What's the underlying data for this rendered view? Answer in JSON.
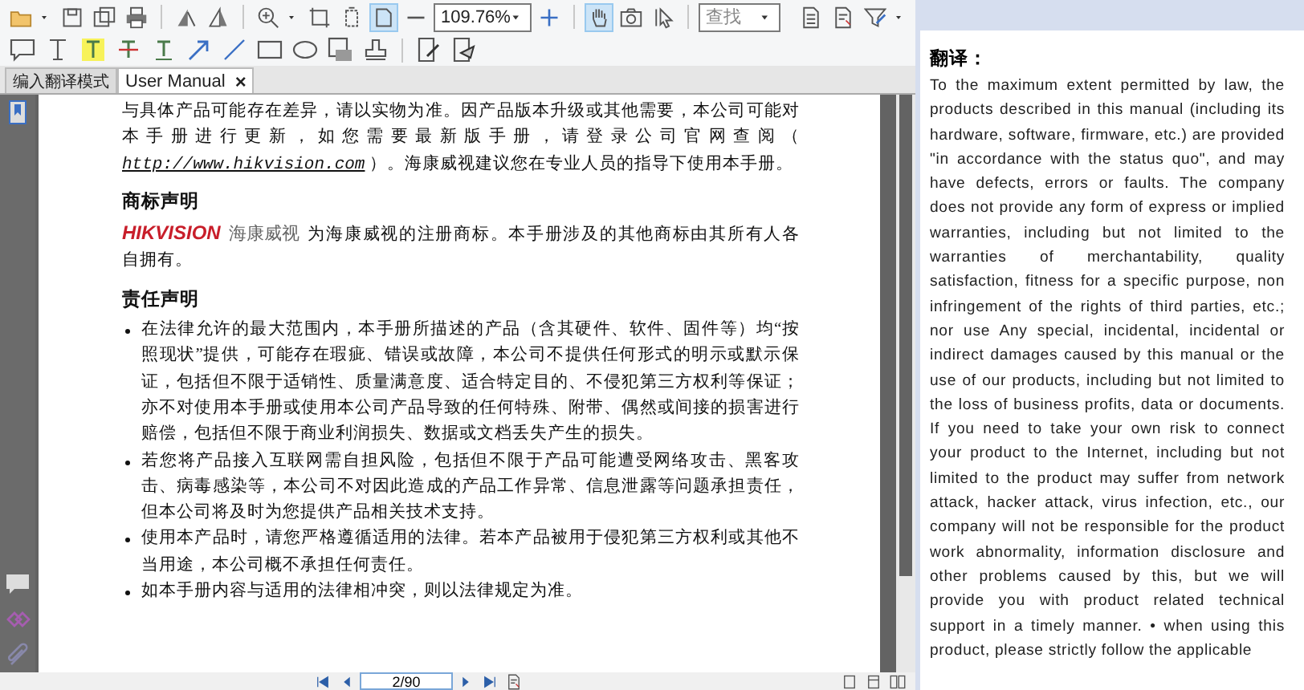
{
  "toolbar": {
    "zoom_value": "109.76%",
    "search_value": "查找",
    "tools": [
      {
        "selected": false
      },
      {
        "selected": false
      },
      {
        "selected": false
      },
      {
        "selected": false
      },
      {
        "selected": false
      },
      {
        "selected": false
      },
      {
        "selected": false
      },
      {
        "selected": false
      },
      {
        "selected": false
      },
      {
        "selected": true
      },
      {
        "selected": false
      },
      {
        "selected": false
      },
      {
        "selected": true
      },
      {
        "selected": false
      },
      {
        "selected": false
      },
      {
        "selected": false
      },
      {
        "selected": false
      },
      {
        "selected": false
      }
    ]
  },
  "tabs": [
    {
      "label": "编入翻译模式",
      "selected": false
    },
    {
      "label": "User Manual",
      "selected": true,
      "close": "×"
    }
  ],
  "document": {
    "intro": {
      "before": "与具体产品可能存在差异，请以实物为准。因产品版本升级或其他需要，本公司可能对本手册进行更新，如您需要最新版手册，请登录公司官网查阅（ ",
      "link": "http://www.hikvision.com",
      "after": " ）。海康威视建议您在专业人员的指导下使用本手册。"
    },
    "trademark_heading": "商标声明",
    "logo": {
      "latin": "HIKVISION",
      "chinese": "海康威视"
    },
    "trademark_text": "为海康威视的注册商标。本手册涉及的其他商标由其所有人各自拥有。",
    "liability_heading": "责任声明",
    "bullets": [
      "在法律允许的最大范围内，本手册所描述的产品（含其硬件、软件、固件等）均“按照现状”提供，可能存在瑕疵、错误或故障，本公司不提供任何形式的明示或默示保证，包括但不限于适销性、质量满意度、适合特定目的、不侵犯第三方权利等保证；亦不对使用本手册或使用本公司产品导致的任何特殊、附带、偶然或间接的损害进行赔偿，包括但不限于商业利润损失、数据或文档丢失产生的损失。",
      "若您将产品接入互联网需自担风险，包括但不限于产品可能遭受网络攻击、黑客攻击、病毒感染等，本公司不对因此造成的产品工作异常、信息泄露等问题承担责任，但本公司将及时为您提供产品相关技术支持。",
      "使用本产品时，请您严格遵循适用的法律。若本产品被用于侵犯第三方权利或其他不当用途，本公司概不承担任何责任。",
      "如本手册内容与适用的法律相冲突，则以法律规定为准。"
    ]
  },
  "page_nav": {
    "page": "2/90"
  },
  "translation": {
    "title": "翻译：",
    "text": "To the maximum extent permitted by law, the products described in this manual (including its hardware, software, firmware, etc.) are provided \"in accordance with the status quo\", and may have defects, errors or faults. The company does not provide any form of express or implied warranties, including but not limited to the warranties of merchantability, quality satisfaction, fitness for a specific purpose, non infringement of the rights of third parties, etc.; nor use Any special, incidental, incidental or indirect damages caused by this manual or the use of our products, including but not limited to the loss of business profits, data or documents. If you need to take your own risk to connect your product to the Internet, including but not limited to the product may suffer from network attack, hacker attack, virus infection, etc., our company will not be responsible for the product work abnormality, information disclosure and other problems caused by this, but we will provide you with product related technical support in a timely manner. • when using this product, please strictly follow the applicable"
  }
}
